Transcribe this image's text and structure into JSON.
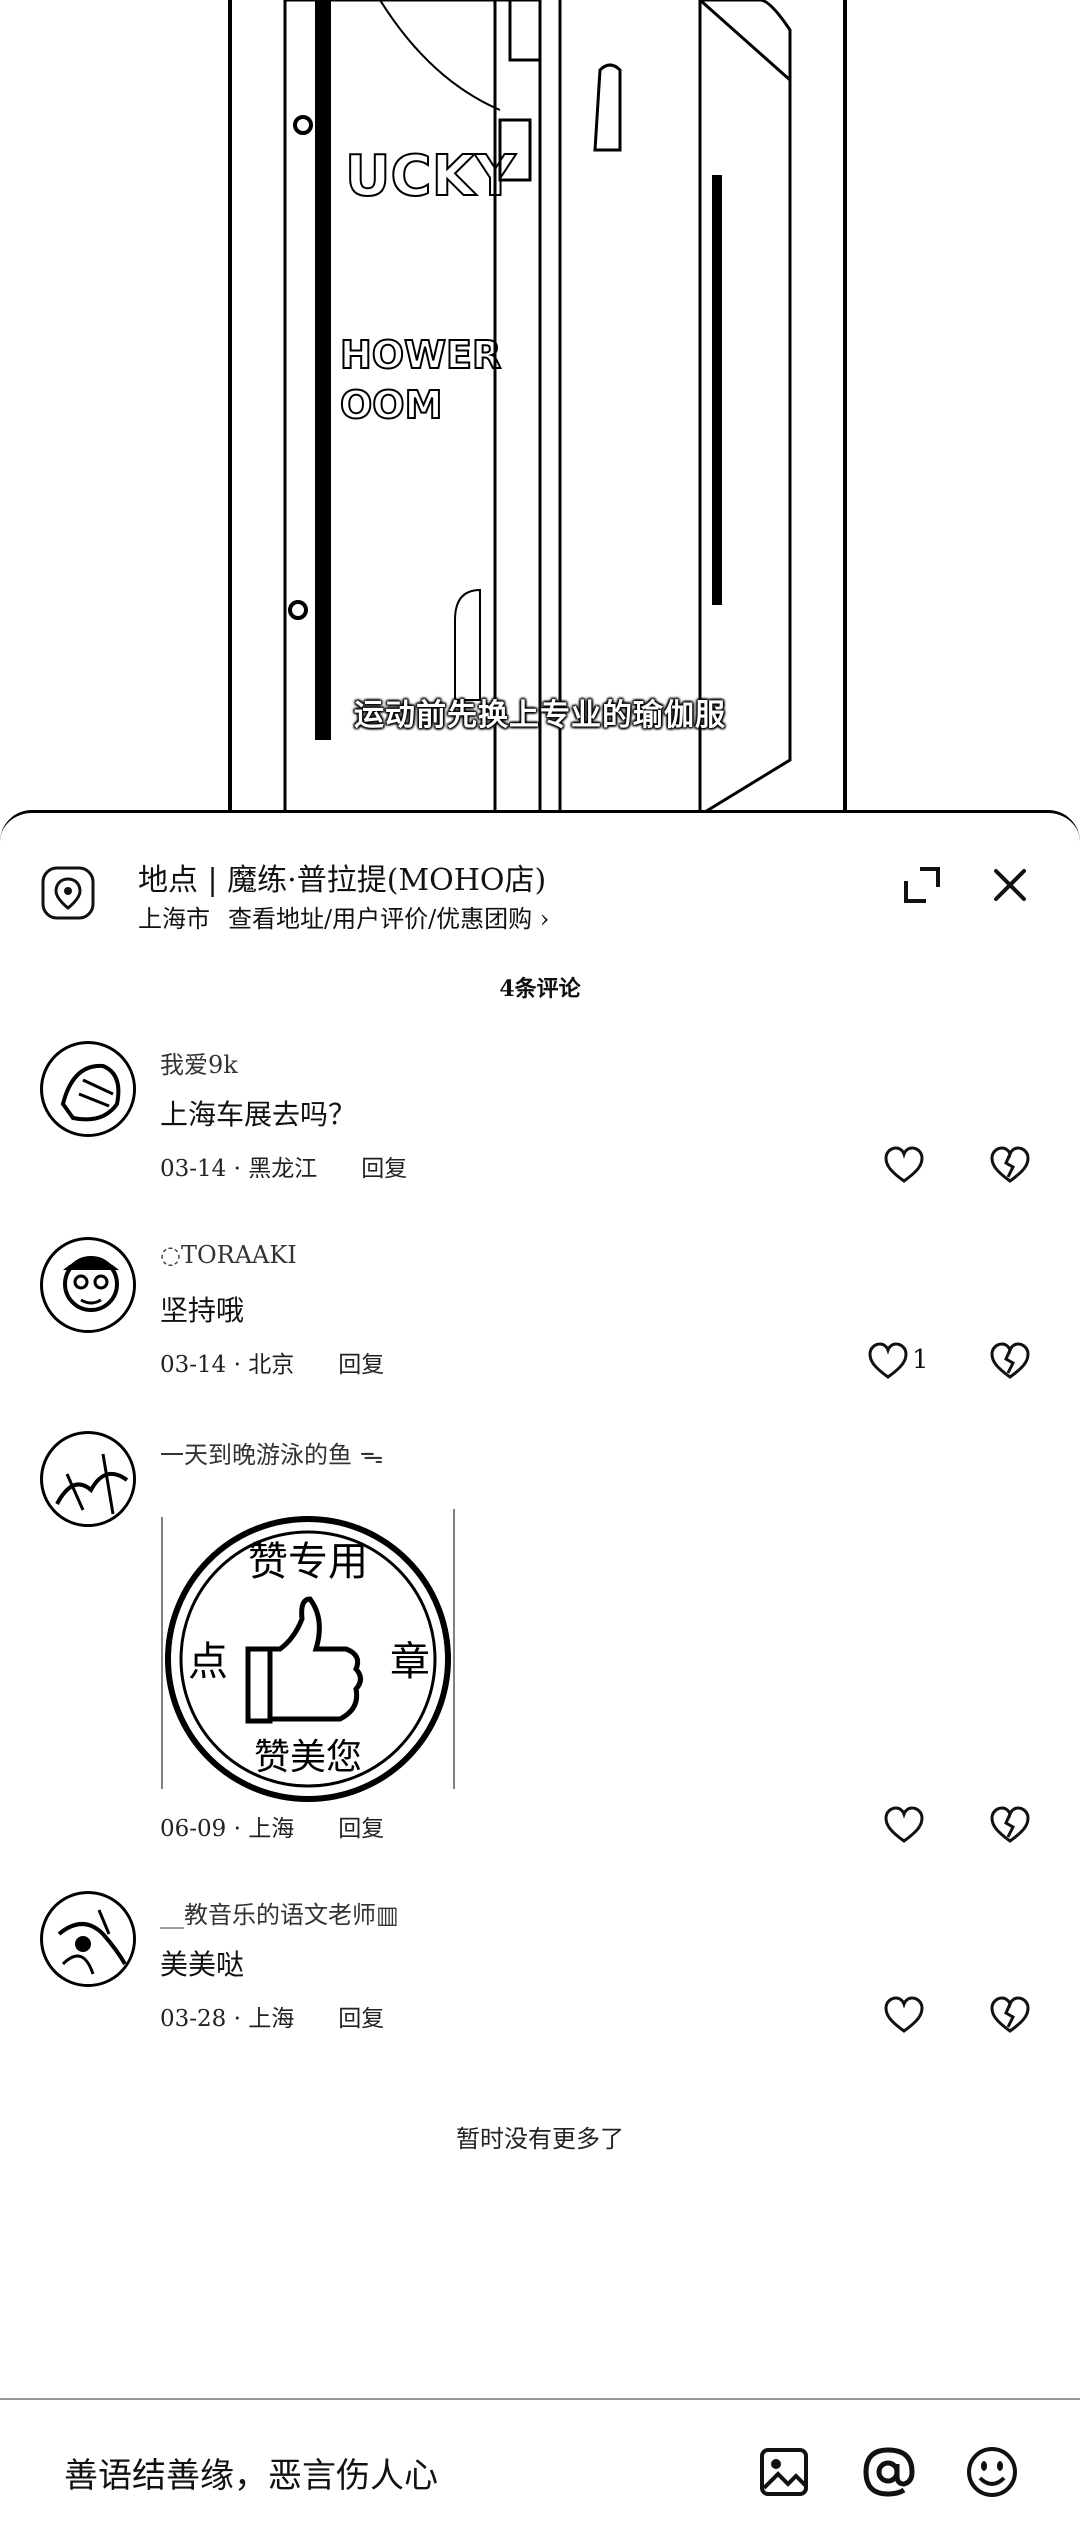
{
  "video": {
    "subtitle": "运动前先换上专业的瑜伽服",
    "sign_text_1": "UCKY",
    "sign_text_2": "HOWER",
    "sign_text_3": "OOM"
  },
  "location": {
    "title": "地点 | 魔练·普拉提(MOHO店)",
    "city": "上海市",
    "link": "查看地址/用户评价/优惠团购 ›"
  },
  "comment_count": "4条评论",
  "comments": [
    {
      "user": "我爱9k",
      "text": "上海车展去吗？",
      "date": "03-14 · 黑龙江",
      "reply": "回复",
      "likes": ""
    },
    {
      "user": "◌TORAAKI",
      "text": "坚持哦",
      "date": "03-14 · 北京",
      "reply": "回复",
      "likes": "1"
    },
    {
      "user": "一天到晚游泳的鱼 ᯓ",
      "text": "",
      "date": "06-09 · 上海",
      "reply": "回复",
      "likes": "",
      "sticker": {
        "top": "赞专用",
        "left": "点",
        "right": "章",
        "bottom": "赞美您"
      }
    },
    {
      "user": "__教音乐的语文老师▥",
      "text": "美美哒",
      "date": "03-28 · 上海",
      "reply": "回复",
      "likes": ""
    }
  ],
  "end_note": "暂时没有更多了",
  "input": {
    "placeholder": "善语结善缘，恶言伤人心"
  },
  "icons": [
    "location-pin-icon",
    "expand-icon",
    "close-icon",
    "heart-icon",
    "broken-heart-icon",
    "image-icon",
    "at-icon",
    "emoji-icon"
  ]
}
